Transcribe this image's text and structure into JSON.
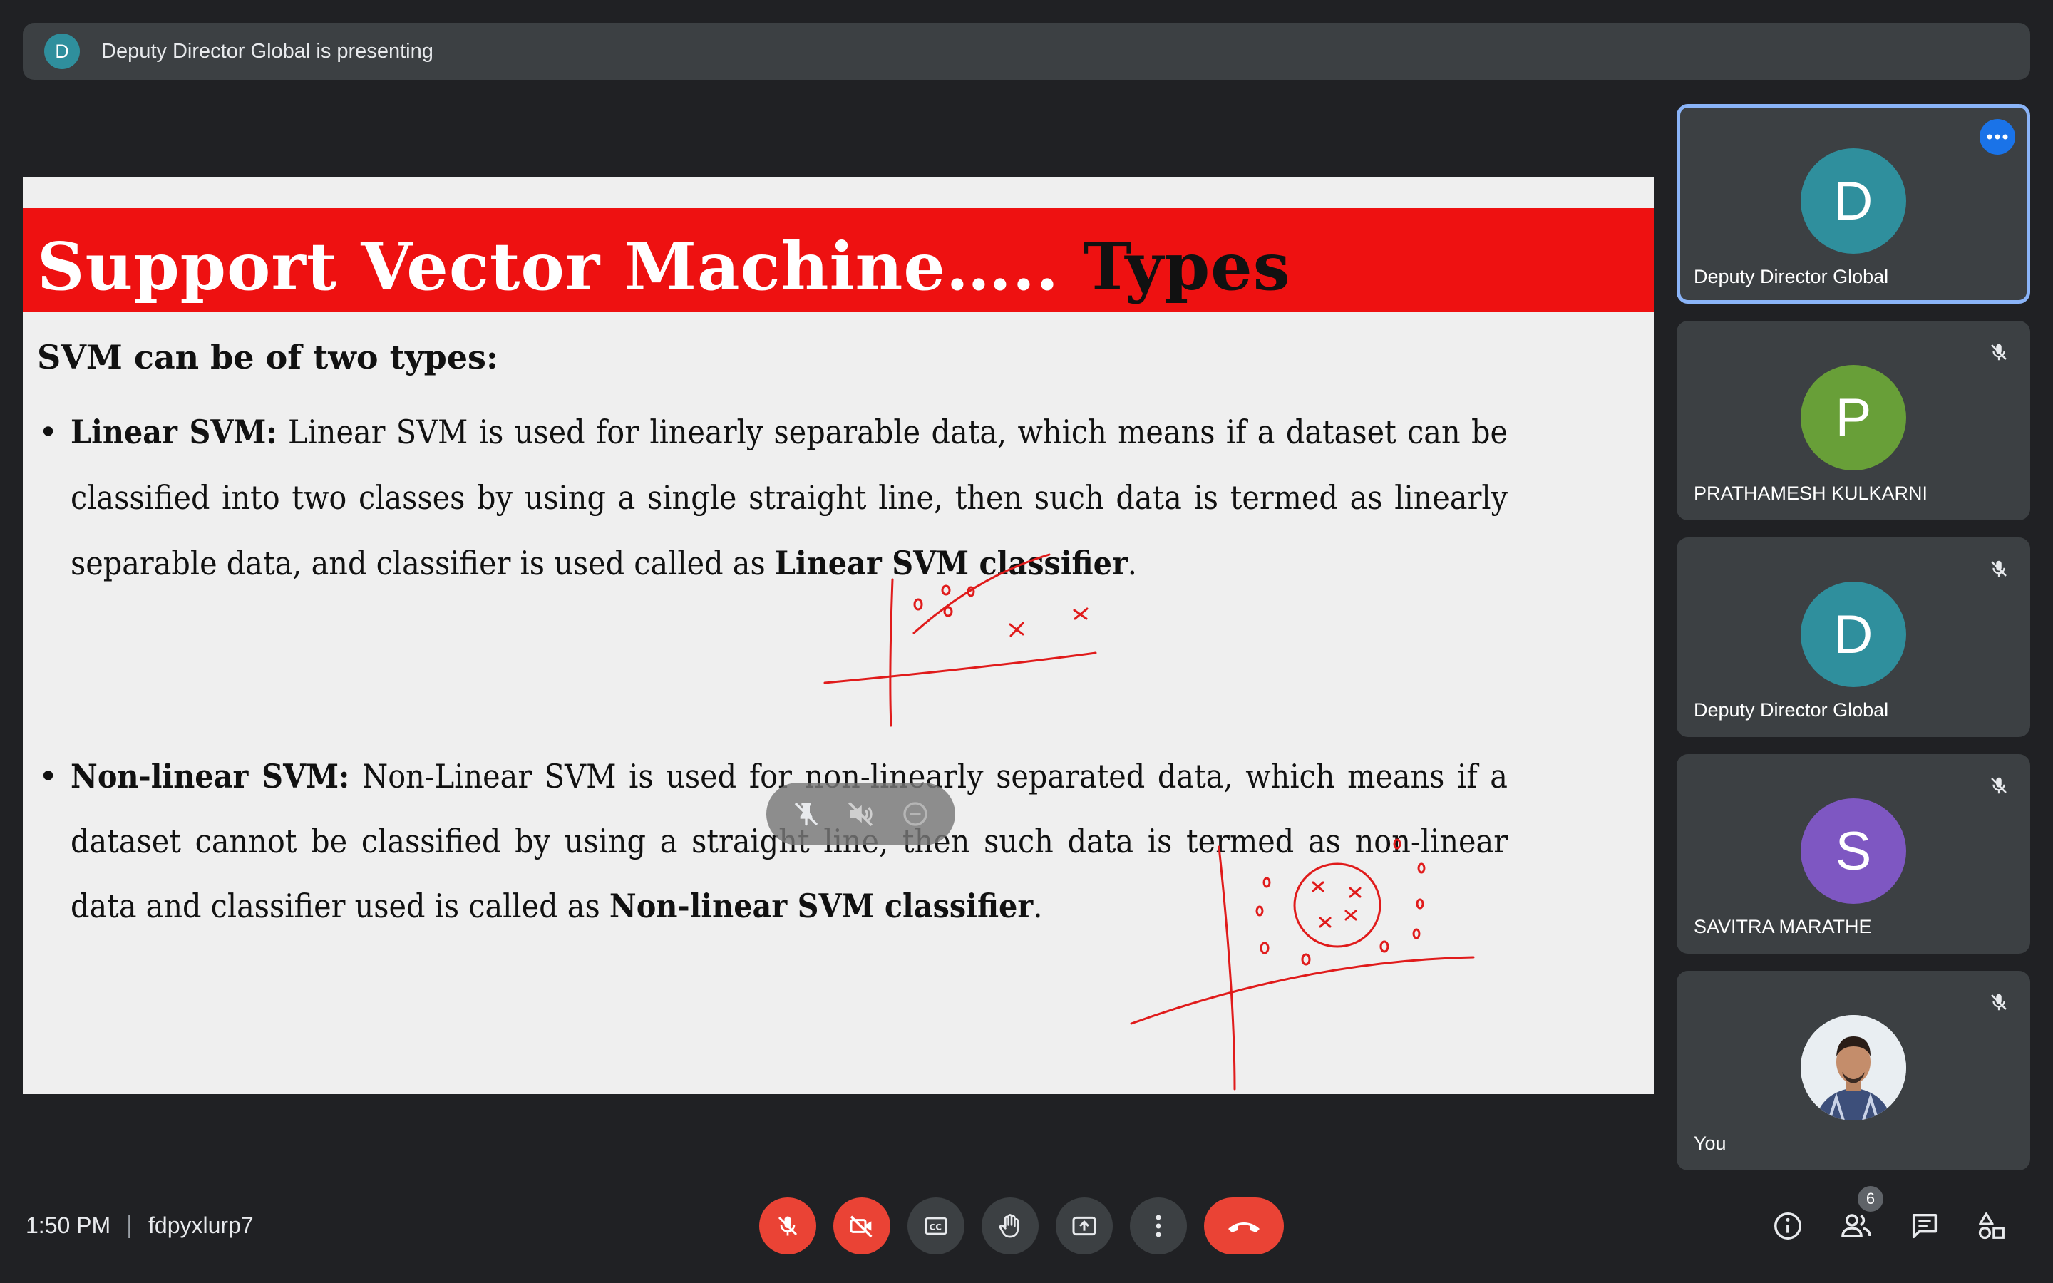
{
  "banner": {
    "avatar_letter": "D",
    "text": "Deputy Director Global is presenting"
  },
  "slide": {
    "title_part1": "Support Vector Machine…..",
    "title_part2": "Types",
    "intro": "SVM can be of two types:",
    "bullet1": {
      "heading": "Linear SVM:",
      "text": "Linear SVM is used for linearly separable data, which means if a dataset can be classified into two classes by using a single straight line, then such data is termed as linearly separable data, and classifier is used called as",
      "bold_tail": "Linear SVM classifier",
      "end": "."
    },
    "bullet2": {
      "heading": "Non-linear SVM:",
      "text": "Non-Linear SVM is used for non-linearly separated data, which means if a dataset cannot be classified by using a straight line, then such data is termed as non-linear data and classifier used is called as",
      "bold_tail": "Non-linear SVM classifier",
      "end": "."
    }
  },
  "pill_icons": [
    "pin-off-icon",
    "volume-off-icon",
    "remove-circle-icon"
  ],
  "participants": [
    {
      "letter": "D",
      "name": "Deputy Director Global",
      "color": "#2f8f9d",
      "active": true
    },
    {
      "letter": "P",
      "name": "PRATHAMESH KULKARNI",
      "color": "#689f38",
      "muted": true
    },
    {
      "letter": "D",
      "name": "Deputy Director Global",
      "color": "#2f8f9d",
      "muted": true
    },
    {
      "letter": "S",
      "name": "SAVITRA MARATHE",
      "color": "#7e57c2",
      "muted": true
    },
    {
      "letter": "",
      "name": "You",
      "muted": true,
      "photo": true
    }
  ],
  "footer": {
    "time": "1:50 PM",
    "meeting_code": "fdpyxlurp7",
    "people_count": "6"
  },
  "colors": {
    "danger": "#ea4335",
    "tile": "#3c4043",
    "accent": "#8ab4f8",
    "background": "#202124"
  }
}
